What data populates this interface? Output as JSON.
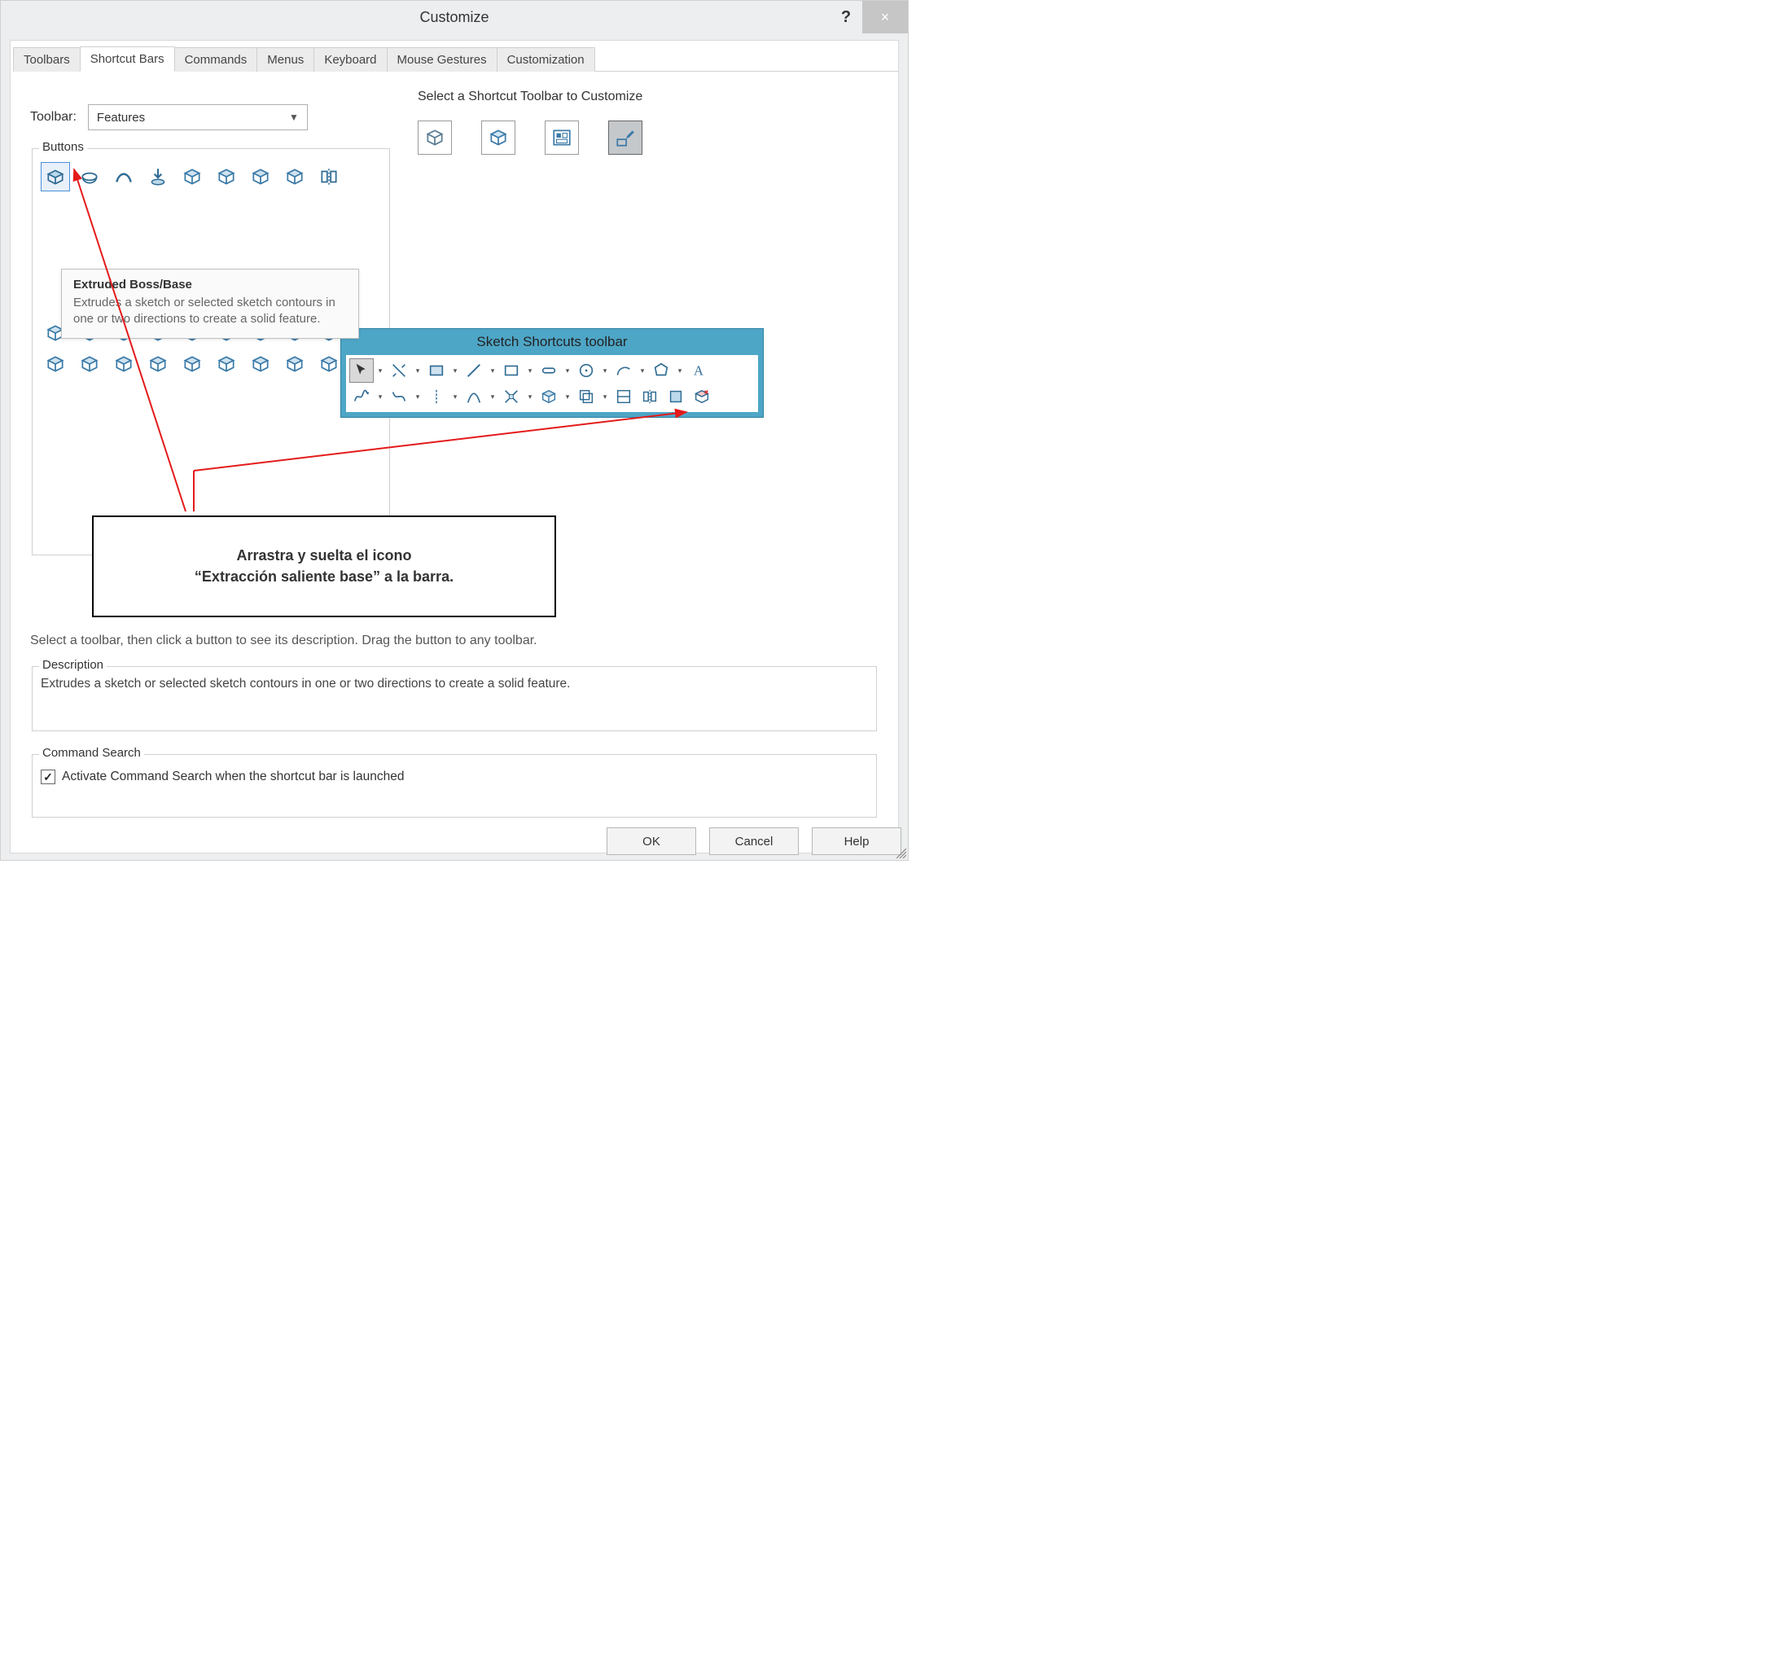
{
  "window": {
    "title": "Customize"
  },
  "tabs": [
    "Toolbars",
    "Shortcut Bars",
    "Commands",
    "Menus",
    "Keyboard",
    "Mouse Gestures",
    "Customization"
  ],
  "active_tab_index": 1,
  "toolbar_label": "Toolbar:",
  "toolbar_selected": "Features",
  "buttons_legend": "Buttons",
  "select_shortcut_label": "Select a Shortcut Toolbar to Customize",
  "shortcut_toolbar_buttons": [
    {
      "name": "part-shortcut",
      "selected": false
    },
    {
      "name": "assembly-shortcut",
      "selected": false
    },
    {
      "name": "drawing-shortcut",
      "selected": false
    },
    {
      "name": "sketch-shortcut",
      "selected": true
    }
  ],
  "tooltip": {
    "title": "Extruded Boss/Base",
    "body": "Extrudes a sketch or selected sketch contours in one or two directions to create a solid feature."
  },
  "sketch_toolbar": {
    "title": "Sketch Shortcuts toolbar",
    "row1": [
      "select-cursor",
      "smart-dimension",
      "corner-rectangle",
      "line",
      "rectangle",
      "slot",
      "circle",
      "arc",
      "polygon",
      "text"
    ],
    "row2": [
      "spline",
      "spline2",
      "centerline",
      "parabola",
      "trim",
      "cube",
      "offset",
      "convert",
      "mirror",
      "block",
      "exit-sketch"
    ]
  },
  "feature_buttons_row1": [
    "extruded-boss",
    "revolved-boss",
    "swept-boss",
    "lofted-boss",
    "boundary-boss",
    "thicken",
    "dome",
    "wrap",
    "mirror"
  ],
  "feature_buttons_bottom": [
    [
      "scale",
      "pattern-linear",
      "pattern-circular",
      "pattern-mirror",
      "pattern-curve",
      "rib",
      "draft",
      "shell",
      "hole-wizard"
    ],
    [
      "split",
      "combine",
      "intersect",
      "delete-face",
      "move-face",
      "check",
      "heal",
      "instant3d",
      "3d-sketch"
    ]
  ],
  "annotation": {
    "line1": "Arrastra y suelta el icono",
    "line2": "“Extracción saliente base” a la barra."
  },
  "instruction": "Select a toolbar, then click a button to see its description. Drag the button to any toolbar.",
  "description": {
    "legend": "Description",
    "text": "Extrudes a sketch or selected sketch contours in one or two directions to create a solid feature."
  },
  "command_search": {
    "legend": "Command Search",
    "checkbox_label": "Activate Command Search when the shortcut bar is launched",
    "checked": true
  },
  "buttons": {
    "ok": "OK",
    "cancel": "Cancel",
    "help": "Help"
  }
}
